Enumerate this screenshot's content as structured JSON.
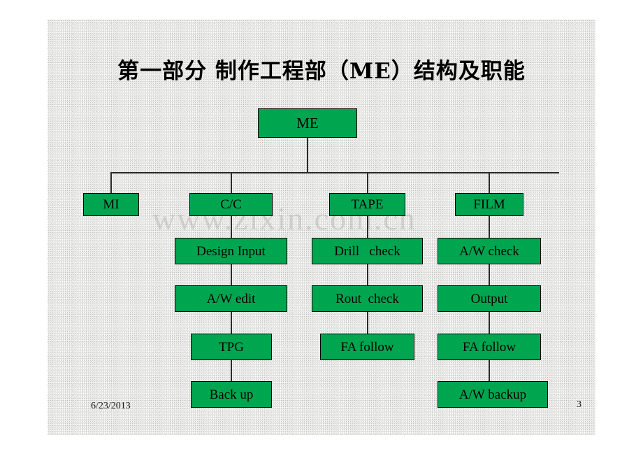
{
  "slide": {
    "title": "第一部分  制作工程部（ME）结构及职能",
    "watermark": "www.zixin.com.cn",
    "background_color": "#e9e9e7",
    "node_fill_color": "#00a550",
    "node_border_color": "#000000",
    "connector_color": "#2b2b2b"
  },
  "footer": {
    "date": "6/23/2013",
    "page_number": "3"
  },
  "diagram": {
    "root": {
      "label": "ME"
    },
    "columns": [
      {
        "head": "MI",
        "items": []
      },
      {
        "head": "C/C",
        "items": [
          "Design Input",
          "A/W edit",
          "TPG",
          "Back up"
        ]
      },
      {
        "head": "TAPE",
        "items": [
          "Drill   check",
          "Rout  check",
          "FA follow"
        ]
      },
      {
        "head": "FILM",
        "items": [
          "A/W check",
          "Output",
          "FA follow",
          "A/W backup"
        ]
      }
    ],
    "nodes": {
      "root": "ME",
      "mi": "MI",
      "cc": "C/C",
      "tape": "TAPE",
      "film": "FILM",
      "design_input": "Design Input",
      "aw_edit": "A/W edit",
      "tpg": "TPG",
      "back_up": "Back up",
      "drill_check": "Drill   check",
      "rout_check": "Rout  check",
      "fa_follow_tape": "FA follow",
      "aw_check": "A/W check",
      "output": "Output",
      "fa_follow_film": "FA follow",
      "aw_backup": "A/W backup"
    }
  }
}
